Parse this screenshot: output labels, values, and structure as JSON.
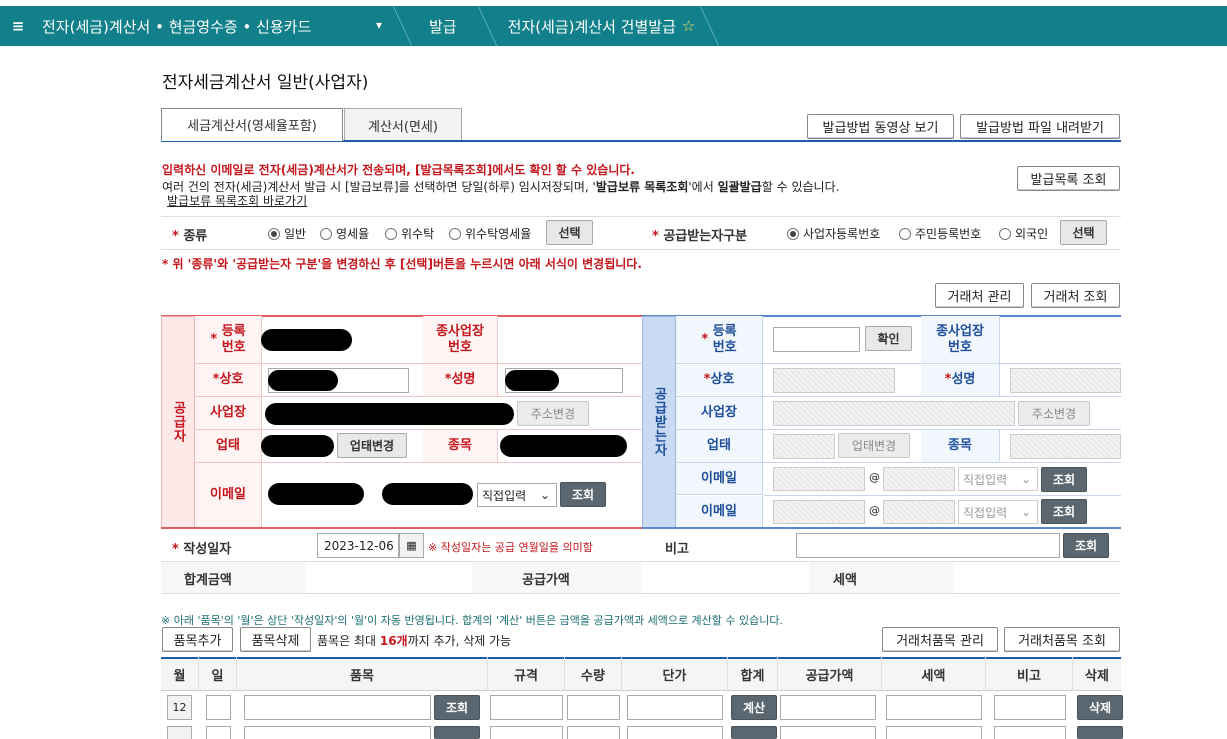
{
  "nav": {
    "menu_label": "전자(세금)계산서 • 현금영수증 • 신용카드",
    "crumb1": "발급",
    "crumb2": "전자(세금)계산서 건별발급"
  },
  "page_title": "전자세금계산서 일반(사업자)",
  "tabs": [
    "세금계산서(영세율포함)",
    "계산서(면세)"
  ],
  "top_buttons": {
    "video": "발급방법 동영상 보기",
    "file": "발급방법 파일 내려받기",
    "list": "발급목록 조회"
  },
  "notice": {
    "line1": "입력하신 이메일로 전자(세금)계산서가 전송되며, [발급목록조회]에서도 확인 할 수 있습니다.",
    "line2_a": "여러 건의 전자(세금)계산서 발급 시 [발급보류]를 선택하면 당일(하루) 임시저장되며, '",
    "line2_b": "발급보류 목록조회",
    "line2_c": "'에서 ",
    "line2_d": "일괄발급",
    "line2_e": "할 수 있습니다.",
    "link": "발급보류 목록조회 바로가기"
  },
  "kind": {
    "label": "종류",
    "options": [
      "일반",
      "영세율",
      "위수탁",
      "위수탁영세율"
    ],
    "selected": "일반",
    "select_btn": "선택"
  },
  "receiver_type": {
    "label": "공급받는자구분",
    "options": [
      "사업자등록번호",
      "주민등록번호",
      "외국인"
    ],
    "selected": "사업자등록번호",
    "select_btn": "선택"
  },
  "change_notice": "* 위 '종류'와 '공급받는자 구분'을 변경하신 후 [선택]버튼을 누르시면 아래 서식이 변경됩니다.",
  "partner_buttons": {
    "manage": "거래처 관리",
    "lookup": "거래처 조회"
  },
  "supplier": {
    "side": "공급자",
    "reg_no": "등록\n번호",
    "sub_no": "종사업장\n번호",
    "name": "상호",
    "ceo": "성명",
    "address": "사업장",
    "addr_change": "주소변경",
    "biz_type": "업태",
    "biz_change": "업태변경",
    "item": "종목",
    "email": "이메일",
    "email_domain": "직접입력",
    "lookup": "조회"
  },
  "receiver": {
    "side": "공급받는자",
    "reg_no": "등록\n번호",
    "confirm": "확인",
    "sub_no": "종사업장\n번호",
    "name": "상호",
    "ceo": "성명",
    "address": "사업장",
    "addr_change": "주소변경",
    "biz_type": "업태",
    "biz_change": "업태변경",
    "item": "종목",
    "email1": "이메일",
    "email2": "이메일",
    "at": "@",
    "email_domain": "직접입력",
    "lookup": "조회"
  },
  "date": {
    "label": "작성일자",
    "value": "2023-12-06",
    "note": "※ 작성일자는 공급 연월일을 의미함",
    "remark": "비고",
    "lookup": "조회"
  },
  "totals": {
    "total": "합계금액",
    "supply": "공급가액",
    "tax": "세액"
  },
  "item_notice": "※ 아래 '품목'의 '월'은 상단 '작성일자'의 '월'이 자동 반영됩니다. 합계의 '계산' 버튼은 금액을 공급가액과 세액으로 계산할 수 있습니다.",
  "item_buttons": {
    "add": "품목추가",
    "del": "품목삭제",
    "manage": "거래처품목 관리",
    "lookup": "거래처품목 조회"
  },
  "item_limit": {
    "a": "품목은 최대 ",
    "b": "16개",
    "c": "까지 추가, 삭제 가능"
  },
  "item_headers": [
    "월",
    "일",
    "품목",
    "규격",
    "수량",
    "단가",
    "합계",
    "공급가액",
    "세액",
    "비고",
    "삭제"
  ],
  "item_row": {
    "month": "12",
    "lookup": "조회",
    "calc": "계산",
    "delete": "삭제"
  },
  "colors": {
    "nav": "#12808a",
    "supplier": "#c4161c",
    "receiver": "#1c4e99",
    "accent": "#1c5fa8"
  }
}
